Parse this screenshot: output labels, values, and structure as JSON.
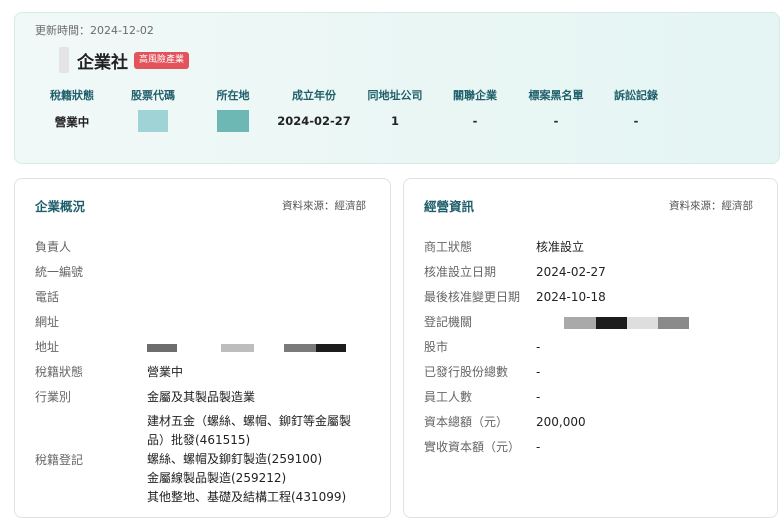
{
  "header": {
    "updated": "更新時間：2024-12-02",
    "company_name": "企業社",
    "risk_badge": "高風險產業",
    "stats": [
      {
        "label": "稅籍狀態",
        "value": "營業中",
        "masked": false
      },
      {
        "label": "股票代碼",
        "value": "",
        "masked": true,
        "mask_color": "#9fd3d6"
      },
      {
        "label": "所在地",
        "value": "",
        "masked": true,
        "mask_color": "#6db7b5"
      },
      {
        "label": "成立年份",
        "value": "2024-02-27",
        "masked": false
      },
      {
        "label": "同地址公司",
        "value": "1",
        "masked": false
      },
      {
        "label": "關聯企業",
        "value": "-",
        "masked": false
      },
      {
        "label": "標案黑名單",
        "value": "-",
        "masked": false
      },
      {
        "label": "訴訟記錄",
        "value": "-",
        "masked": false
      }
    ]
  },
  "overview": {
    "title": "企業概況",
    "source": "資料來源：經濟部",
    "rows": [
      {
        "label": "負責人",
        "value": ""
      },
      {
        "label": "統一編號",
        "value": ""
      },
      {
        "label": "電話",
        "value": ""
      },
      {
        "label": "網址",
        "value": ""
      },
      {
        "label": "地址",
        "value": ""
      },
      {
        "label": "稅籍狀態",
        "value": "營業中"
      },
      {
        "label": "行業別",
        "value": "金屬及其製品製造業"
      }
    ],
    "tax_registration_label": "稅籍登記",
    "tax_registration_lines": [
      "建材五金（螺絲、螺帽、鉚釘等金屬製",
      "品）批發(461515)",
      "螺絲、螺帽及鉚釘製造(259100)",
      "金屬線製品製造(259212)",
      "其他整地、基礎及結構工程(431099)"
    ]
  },
  "business": {
    "title": "經營資訊",
    "source": "資料來源：經濟部",
    "rows": [
      {
        "label": "商工狀態",
        "value": "核准設立"
      },
      {
        "label": "核准設立日期",
        "value": "2024-02-27"
      },
      {
        "label": "最後核准變更日期",
        "value": "2024-10-18"
      },
      {
        "label": "登記機關",
        "value": ""
      },
      {
        "label": "股市",
        "value": "-"
      },
      {
        "label": "已發行股份總數",
        "value": "-"
      },
      {
        "label": "員工人數",
        "value": "-"
      },
      {
        "label": "資本總額（元）",
        "value": "200,000"
      },
      {
        "label": "實收資本額（元）",
        "value": "-"
      }
    ]
  },
  "colors": {
    "accent": "#1f5f6b",
    "badge": "#e2535b",
    "header_bg": "#eef8f6"
  }
}
